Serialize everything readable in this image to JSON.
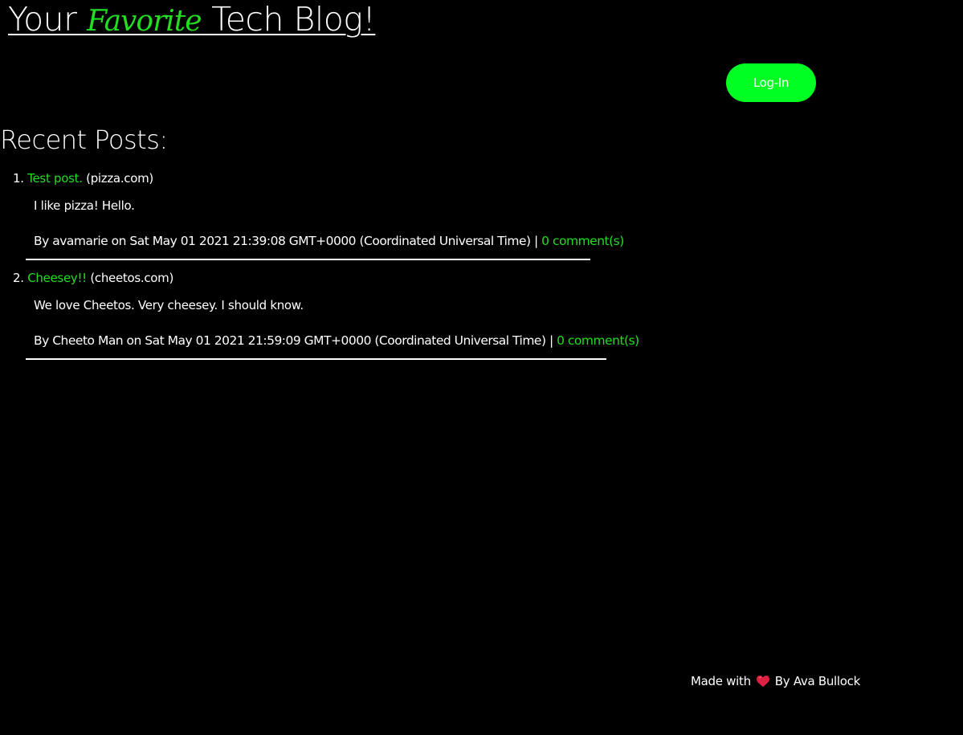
{
  "header": {
    "title_part1": "Your ",
    "title_fancy": "Favorite",
    "title_part2": " Tech Blog!"
  },
  "login_button": "Log-In",
  "recent_posts": {
    "heading": "Recent Posts:",
    "posts": [
      {
        "number": "1.",
        "title": "Test post.",
        "domain": "(pizza.com)",
        "body": "I like pizza! Hello.",
        "meta": "By avamarie on Sat May 01 2021 21:39:08 GMT+0000 (Coordinated Universal Time) | ",
        "comments": "0 comment(s)"
      },
      {
        "number": "2.",
        "title": "Cheesey!!",
        "domain": "(cheetos.com)",
        "body": "We love Cheetos. Very cheesey. I should know.",
        "meta": "By Cheeto Man on Sat May 01 2021 21:59:09 GMT+0000 (Coordinated Universal Time) | ",
        "comments": "0 comment(s)"
      }
    ]
  },
  "footer": {
    "made_with": "Made with",
    "heart_icon": "heart-icon",
    "author": "By Ava Bullock"
  },
  "colors": {
    "background": "#000000",
    "accent_green": "#22dd22",
    "button_green": "#00ff22",
    "text": "#ffffff",
    "heart": "#e02040"
  }
}
